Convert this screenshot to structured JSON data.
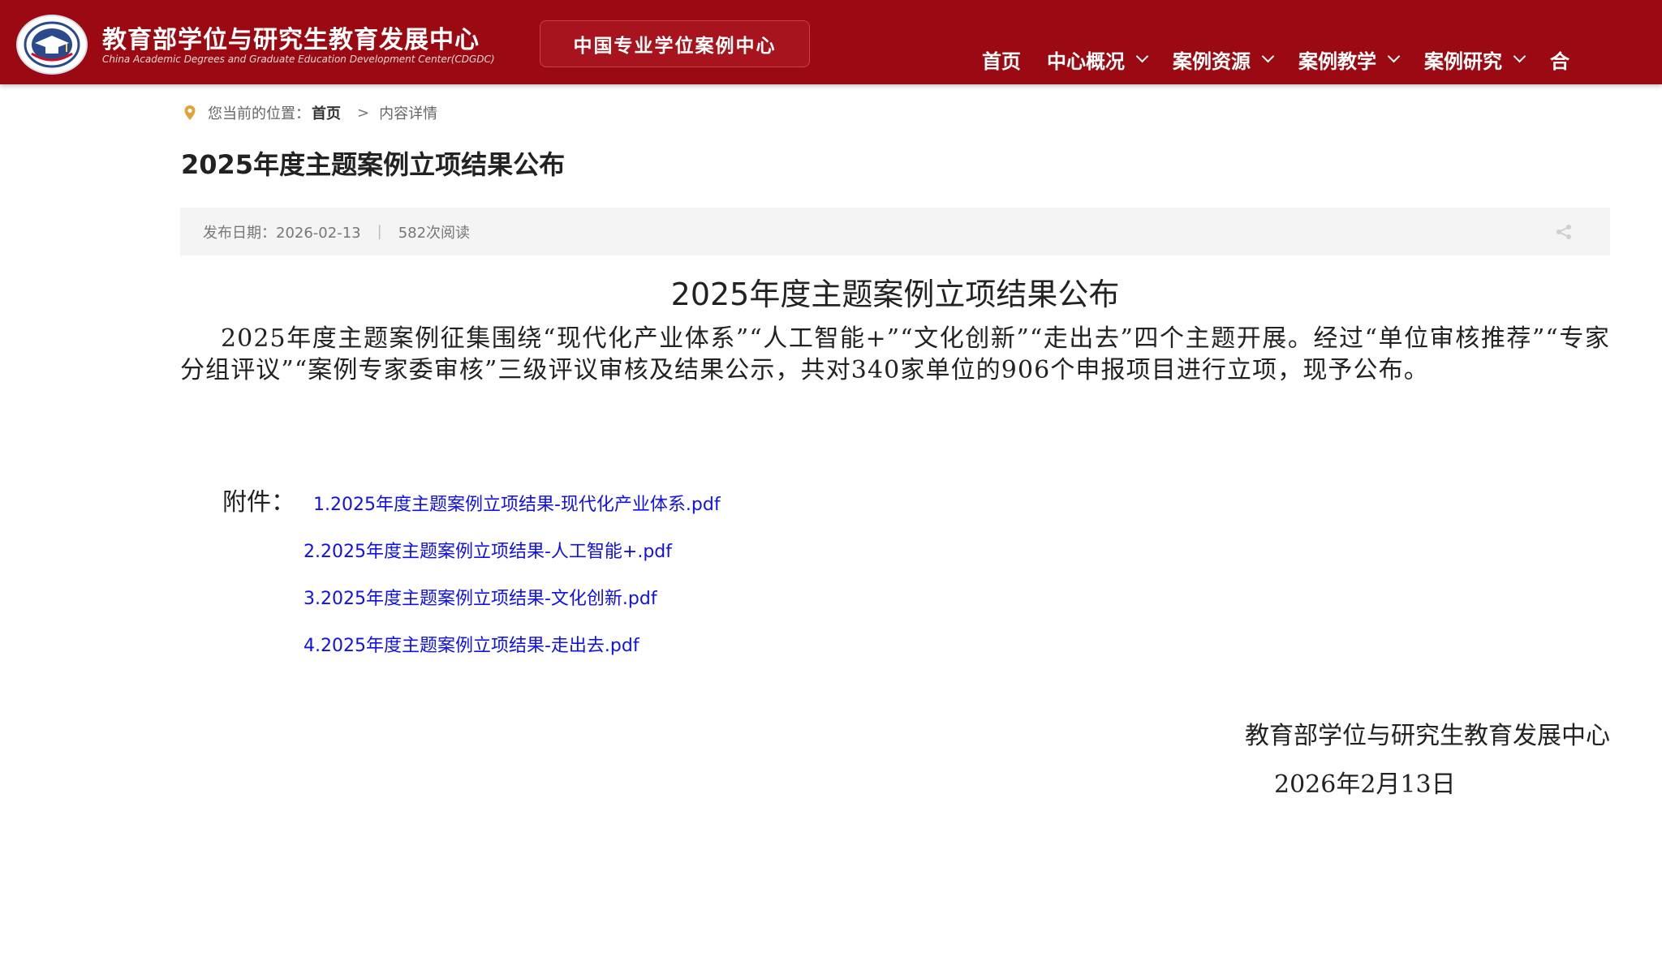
{
  "header": {
    "org_name": "教育部学位与研究生教育发展中心",
    "org_name_en": "China Academic Degrees and Graduate Education Development Center(CDGDC)",
    "subsite": "中国专业学位案例中心",
    "colors": {
      "brand": "#9b0a12",
      "subsite_bg": "#a8141d"
    },
    "nav": [
      {
        "label": "首页",
        "dropdown": false
      },
      {
        "label": "中心概况",
        "dropdown": true
      },
      {
        "label": "案例资源",
        "dropdown": true
      },
      {
        "label": "案例教学",
        "dropdown": true
      },
      {
        "label": "案例研究",
        "dropdown": true
      },
      {
        "label": "合",
        "dropdown": false
      }
    ]
  },
  "breadcrumb": {
    "prefix": "您当前的位置：",
    "home": "首页",
    "separator": ">",
    "current": "内容详情"
  },
  "article": {
    "title": "2025年度主题案例立项结果公布",
    "meta": {
      "date": "发布日期：2026-02-13",
      "divider": "|",
      "views": "582次阅读"
    },
    "content_title": "2025年度主题案例立项结果公布",
    "body": "2025年度主题案例征集围绕“现代化产业体系”“人工智能+”“文化创新”“走出去”四个主题开展。经过“单位审核推荐”“专家分组评议”“案例专家委审核”三级评议审核及结果公示，共对340家单位的906个申报项目进行立项，现予公布。",
    "attachment_label": "附件：",
    "attachments": [
      "1.2025年度主题案例立项结果-现代化产业体系.pdf",
      "2.2025年度主题案例立项结果-人工智能+.pdf",
      "3.2025年度主题案例立项结果-文化创新.pdf",
      "4.2025年度主题案例立项结果-走出去.pdf"
    ],
    "link_color": "#1010ee",
    "signature_org": "教育部学位与研究生教育发展中心",
    "signature_date": "2026年2月13日"
  }
}
